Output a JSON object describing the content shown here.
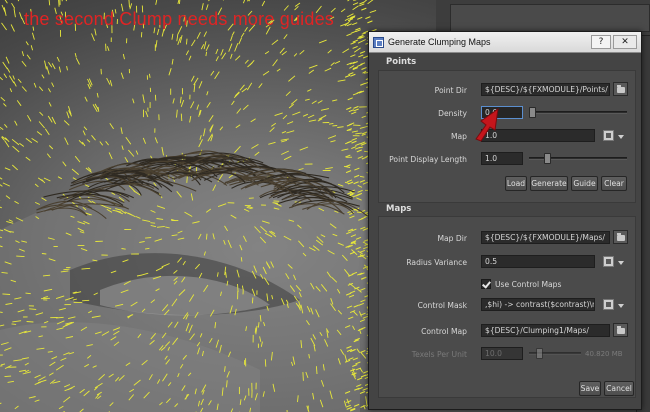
{
  "annotation": {
    "text": "the second Clump needs more guides",
    "color": "#e02424"
  },
  "colors": {
    "guides": "#e8e83a",
    "dialog_bg": "#444444",
    "field_bg": "#2b2b2b",
    "annotation_arrow": "#c4161c"
  },
  "dialog": {
    "title": "Generate Clumping Maps",
    "icon": "maya-window-icon",
    "help_label": "?",
    "close_label": "✕",
    "points": {
      "title": "Points",
      "point_dir": {
        "label": "Point Dir",
        "value": "${DESC}/${FXMODULE}/Points/"
      },
      "density": {
        "label": "Density",
        "value": "0.6",
        "slider_fraction": 0.0
      },
      "map": {
        "label": "Map",
        "value": "1.0"
      },
      "point_display_length": {
        "label": "Point Display Length",
        "value": "1.0",
        "slider_fraction": 0.15
      },
      "buttons": [
        "Load",
        "Generate",
        "Guide",
        "Clear"
      ]
    },
    "maps": {
      "title": "Maps",
      "map_dir": {
        "label": "Map Dir",
        "value": "${DESC}/${FXMODULE}/Maps/"
      },
      "radius_variance": {
        "label": "Radius Variance",
        "value": "0.5"
      },
      "use_control_maps": {
        "label": "Use Control Maps",
        "checked": true
      },
      "control_mask": {
        "label": "Control Mask",
        "value": ",$hi) -> contrast($contrast)\\n\\n"
      },
      "control_map": {
        "label": "Control Map",
        "value": "${DESC}/Clumping1/Maps/"
      },
      "texels_per_unit": {
        "label": "Texels Per Unit",
        "value": "10.0",
        "slider_value": "40.820 MB",
        "slider_fraction": 0.1
      }
    },
    "footer": {
      "save_label": "Save",
      "cancel_label": "Cancel"
    }
  }
}
